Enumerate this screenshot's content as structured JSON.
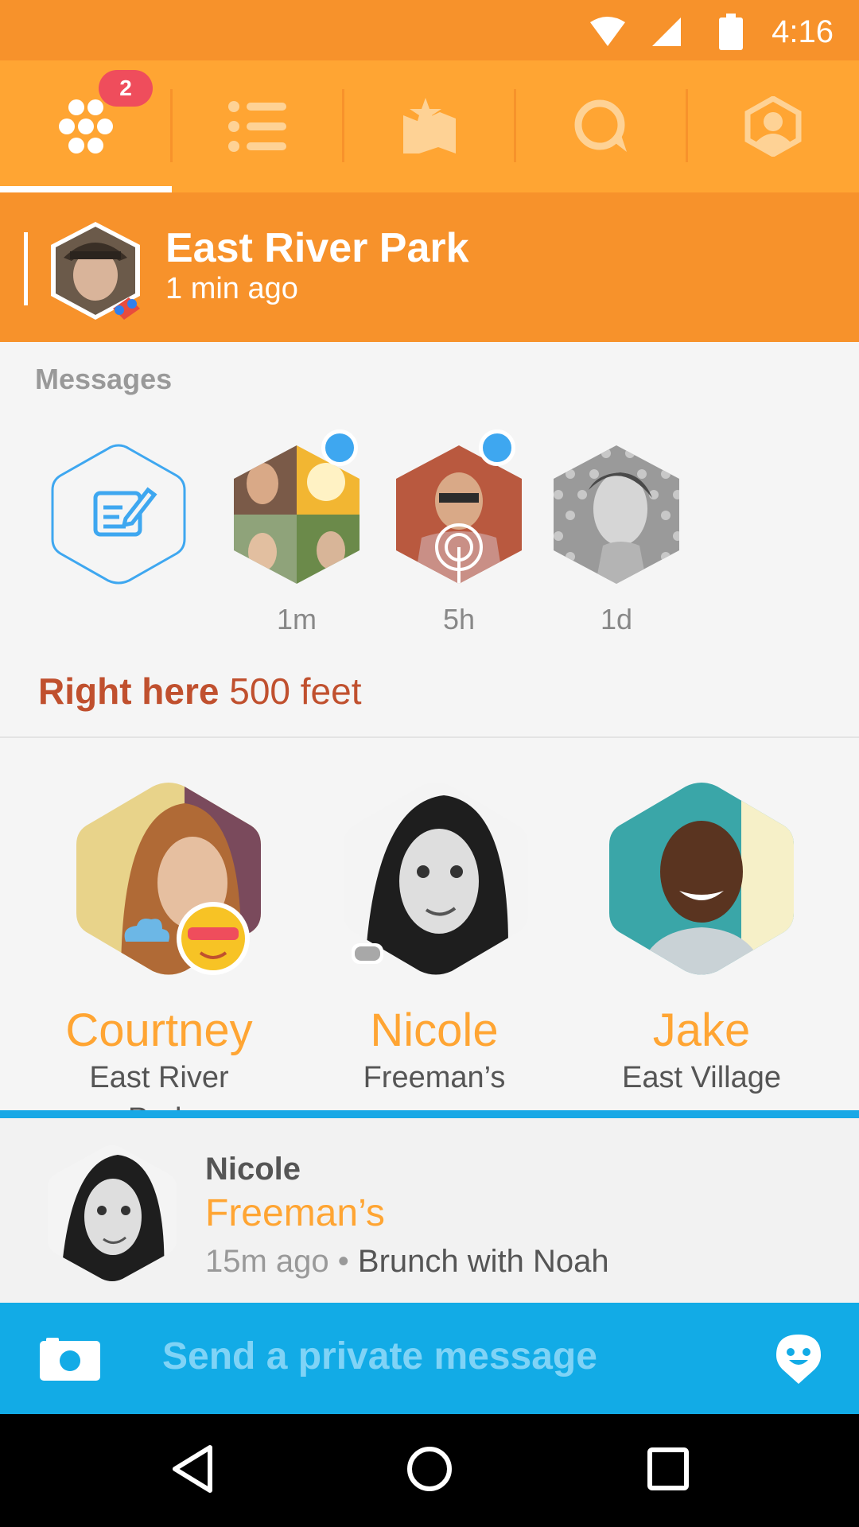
{
  "status_bar": {
    "time": "4:16"
  },
  "tabs": {
    "badge": "2",
    "items": [
      "hive-icon",
      "list-icon",
      "map-icon",
      "chat-icon",
      "profile-icon"
    ]
  },
  "checkin": {
    "place": "East River Park",
    "ago": "1 min ago"
  },
  "messages": {
    "title": "Messages",
    "items": [
      {
        "time": "1m",
        "unread": true
      },
      {
        "time": "5h",
        "unread": true
      },
      {
        "time": "1d",
        "unread": false
      }
    ]
  },
  "proximity": {
    "label": "Right here",
    "distance": "500 feet"
  },
  "people": [
    {
      "name": "Courtney",
      "place": "East River",
      "place_more": "Park"
    },
    {
      "name": "Nicole",
      "place": "Freeman’s"
    },
    {
      "name": "Jake",
      "place": "East Village"
    }
  ],
  "card": {
    "name": "Nicole",
    "venue": "Freeman’s",
    "ago": "15m ago",
    "separator": " • ",
    "note": "Brunch with Noah"
  },
  "composer": {
    "placeholder": "Send a private message"
  },
  "colors": {
    "status_bar": "#f7922b",
    "tab_bar": "#ffa533",
    "accent_orange": "#ffa533",
    "composer_blue": "#12abe6",
    "unread_dot": "#3ea7f0",
    "badge_red": "#ef4d5c"
  }
}
